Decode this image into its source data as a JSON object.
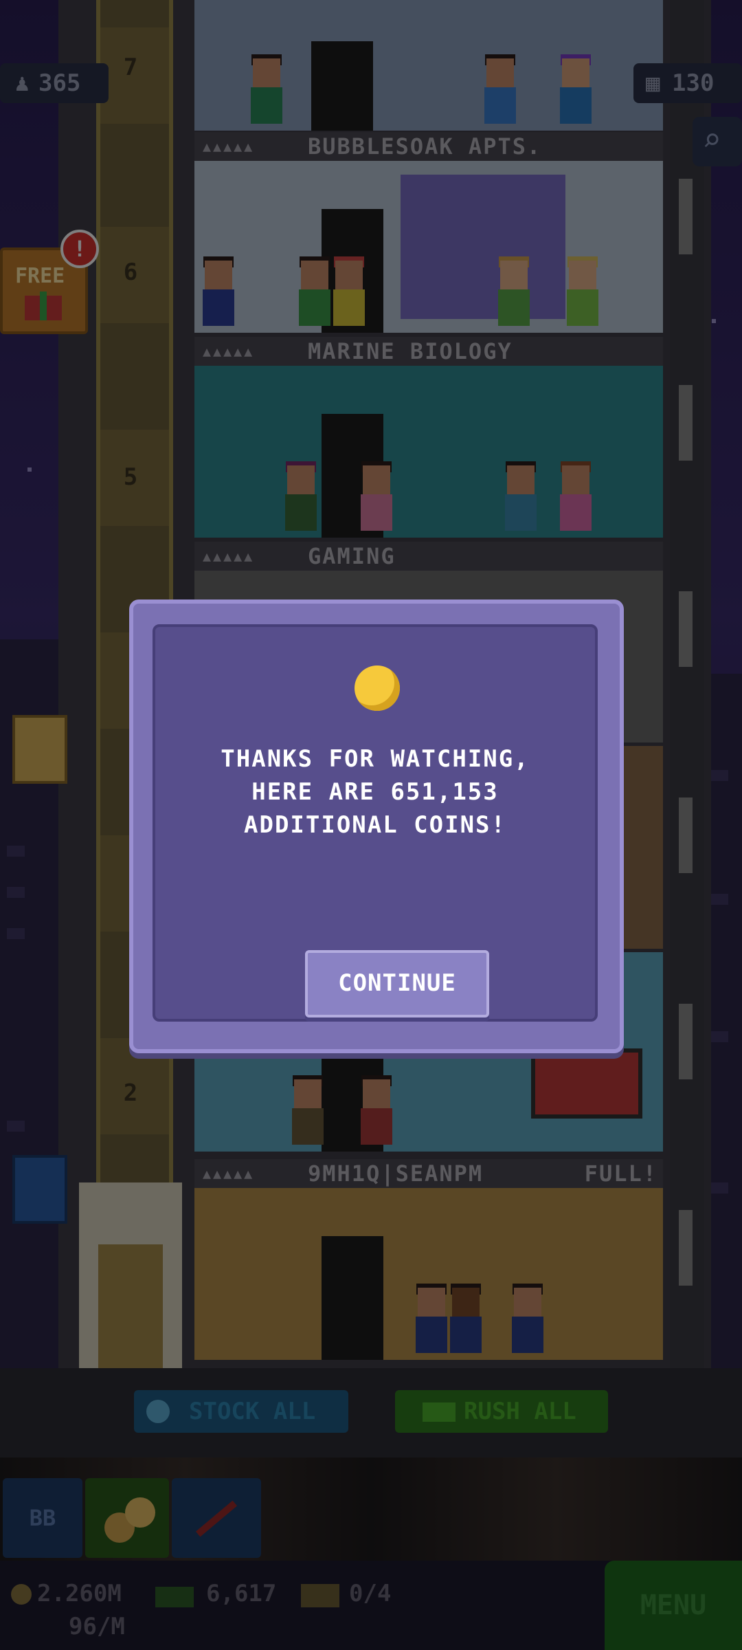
{
  "hud": {
    "population": "365",
    "floors_count": "130",
    "free_label": "FREE",
    "alert_mark": "!"
  },
  "floors": [
    {
      "number": "7"
    },
    {
      "number": "6",
      "name": "BUBBLESOAK APTS."
    },
    {
      "number": "5",
      "name": "MARINE BIOLOGY"
    },
    {
      "name": "GAMING"
    },
    {
      "number": "2"
    },
    {
      "name": "9MH1Q|SEANPM",
      "status": "FULL!"
    }
  ],
  "dialog": {
    "message_line1": "THANKS FOR WATCHING,",
    "message_line2": "HERE ARE 651,153",
    "message_line3": "ADDITIONAL COINS!",
    "continue_label": "CONTINUE"
  },
  "actions": {
    "stock_all": "STOCK ALL",
    "rush_all": "RUSH ALL"
  },
  "toolbar": {
    "bb_label": "BB"
  },
  "status": {
    "coins": "2.260M",
    "coins_rate": "96/M",
    "bux": "6,617",
    "tickets": "0/4",
    "menu_label": "MENU"
  },
  "colors": {
    "dialog_bg": "#574e8c",
    "dialog_border": "#7b71b3",
    "stock_button": "#1e5c86",
    "rush_button": "#2f7a1f",
    "menu_button": "#1e6a1e"
  }
}
